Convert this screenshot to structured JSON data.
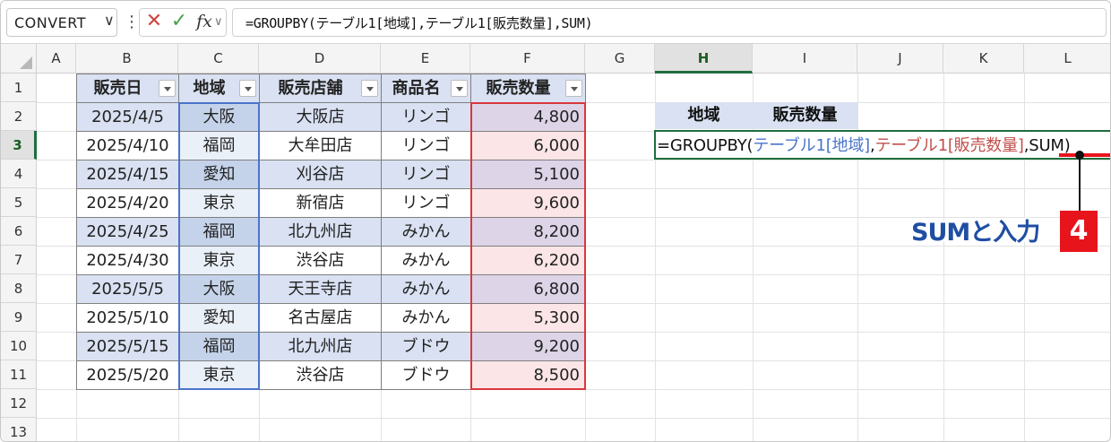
{
  "formula_bar": {
    "name_box": "CONVERT",
    "dropdown_glyph": "∨",
    "dots_glyph": "⋮",
    "cancel_glyph": "✕",
    "enter_glyph": "✓",
    "fx_label": "fx",
    "fx_dropdown_glyph": "∨",
    "formula": "=GROUPBY(テーブル1[地域],テーブル1[販売数量],SUM)"
  },
  "columns": [
    "A",
    "B",
    "C",
    "D",
    "E",
    "F",
    "G",
    "H",
    "I",
    "J",
    "K",
    "L"
  ],
  "rows": [
    "1",
    "2",
    "3",
    "4",
    "5",
    "6",
    "7",
    "8",
    "9",
    "10",
    "11",
    "12",
    "13"
  ],
  "selected_column": "H",
  "selected_row": "3",
  "table": {
    "headers": [
      "販売日",
      "地域",
      "販売店舗",
      "商品名",
      "販売数量"
    ],
    "rows": [
      [
        "2025/4/5",
        "大阪",
        "大阪店",
        "リンゴ",
        "4,800"
      ],
      [
        "2025/4/10",
        "福岡",
        "大牟田店",
        "リンゴ",
        "6,000"
      ],
      [
        "2025/4/15",
        "愛知",
        "刈谷店",
        "リンゴ",
        "5,100"
      ],
      [
        "2025/4/20",
        "東京",
        "新宿店",
        "リンゴ",
        "9,600"
      ],
      [
        "2025/4/25",
        "福岡",
        "北九州店",
        "みかん",
        "8,200"
      ],
      [
        "2025/4/30",
        "東京",
        "渋谷店",
        "みかん",
        "6,200"
      ],
      [
        "2025/5/5",
        "大阪",
        "天王寺店",
        "みかん",
        "6,800"
      ],
      [
        "2025/5/10",
        "愛知",
        "名古屋店",
        "みかん",
        "5,300"
      ],
      [
        "2025/5/15",
        "福岡",
        "北九州店",
        "ブドウ",
        "9,200"
      ],
      [
        "2025/5/20",
        "東京",
        "渋谷店",
        "ブドウ",
        "8,500"
      ]
    ]
  },
  "result": {
    "header_region": "地域",
    "header_qty": "販売数量",
    "formula_parts": [
      "=GROUPBY(",
      "テーブル1[地域]",
      ",",
      "テーブル1[販売数量]",
      ",SUM)"
    ]
  },
  "annotation": {
    "text": "SUMと入力",
    "step": "4"
  },
  "colors": {
    "band": "#d9e1f2",
    "ref_blue": "#4a74c9",
    "ref_red": "#c0504d",
    "accent_red": "#e8141c",
    "callout_blue": "#1f4ea3",
    "select_green": "#1e6e3e"
  }
}
